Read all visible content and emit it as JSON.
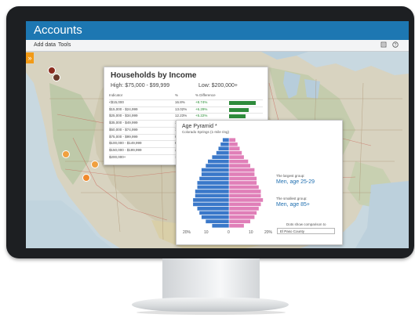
{
  "app": {
    "title": "Accounts"
  },
  "menu": {
    "add_data": "Add data",
    "tools": "Tools"
  },
  "icons": {
    "expand": "double-chevron-right-icon",
    "bookmark": "bookmark-icon",
    "help": "help-icon",
    "marker": "map-marker-icon"
  },
  "colors": {
    "titlebar": "#1d77b2",
    "accent": "#f29a16",
    "positive": "#238b2e",
    "male": "#3a78c9",
    "female": "#e07fb8"
  },
  "income_panel": {
    "title": "Households by Income",
    "high": "High: $75,000 - $99,999",
    "low": "Low: $200,000+",
    "columns": [
      "Indicator",
      "%",
      "% Difference"
    ],
    "rows": [
      {
        "label": "<$15,000",
        "pct": "16.8%",
        "diff": "+8.74%",
        "bar": 0.9
      },
      {
        "label": "$15,000 - $24,999",
        "pct": "13.02%",
        "diff": "+6.29%",
        "bar": 0.66
      },
      {
        "label": "$25,000 - $34,999",
        "pct": "12.23%",
        "diff": "+5.22%",
        "bar": 0.56
      },
      {
        "label": "$35,000 - $49,999",
        "pct": "18.13%",
        "diff": "+7.19%",
        "bar": 0.76
      },
      {
        "label": "$50,000 - $74,999",
        "pct": "18.01%",
        "diff": "",
        "bar": 0
      },
      {
        "label": "$75,000 - $99,999",
        "pct": "9.66%",
        "diff": "",
        "bar": 0
      },
      {
        "label": "$100,000 - $149,999",
        "pct": "8.43%",
        "diff": "",
        "bar": 0
      },
      {
        "label": "$150,000 - $199,999",
        "pct": "2.35%",
        "diff": "",
        "bar": 0
      },
      {
        "label": "$200,000+",
        "pct": "1.4%",
        "diff": "",
        "bar": 0
      }
    ]
  },
  "pyramid_panel": {
    "title": "Age Pyramid *",
    "subtitle": "Colorado Springs (1-mile ring)",
    "axis_ticks": [
      "20%",
      "10",
      "0",
      "10",
      "20%"
    ],
    "largest_label": "The largest group:",
    "largest_value": "Men, age 25-29",
    "smallest_label": "The smallest group:",
    "smallest_value": "Men, age 85+",
    "comparison_label": "Dots show comparison to",
    "comparison_value": "El Paso County",
    "male_values": [
      8,
      11,
      13,
      14,
      15,
      17,
      17,
      16,
      16,
      15,
      15,
      14,
      13,
      13,
      11,
      10,
      8,
      6,
      5,
      4,
      3
    ],
    "female_values": [
      7,
      10,
      12,
      13,
      14,
      15,
      16,
      15,
      15,
      14,
      13,
      13,
      12,
      12,
      10,
      9,
      7,
      6,
      5,
      4,
      3
    ]
  }
}
